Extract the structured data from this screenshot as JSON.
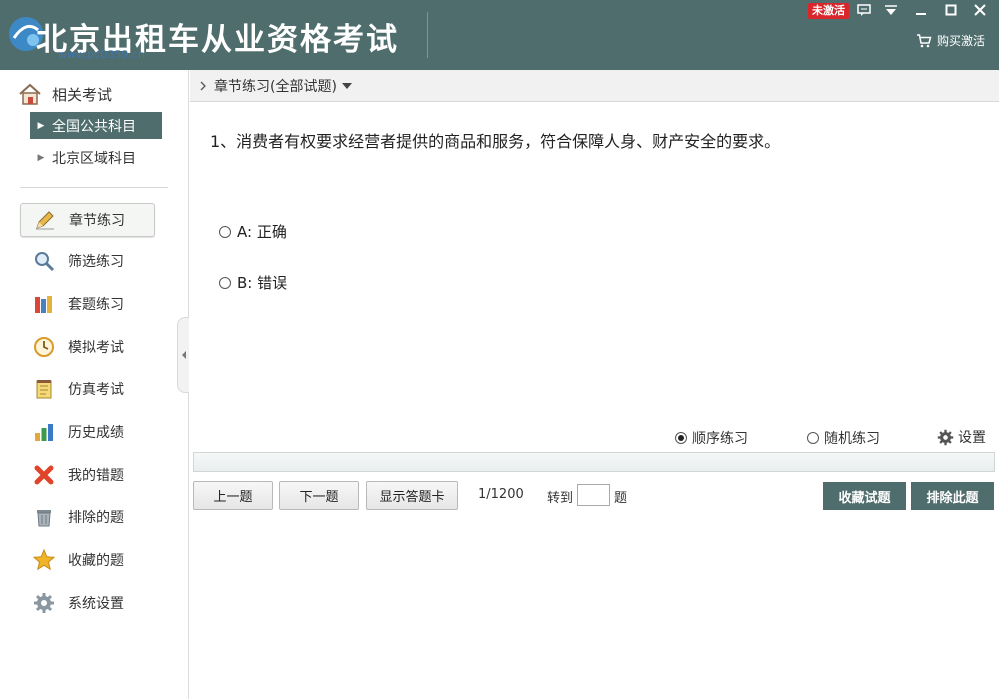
{
  "colors": {
    "accent": "#4f6d6c",
    "badge": "#d9262a"
  },
  "titlebar": {
    "title": "北京出租车从业资格考试",
    "watermark": "www.pc0359.cn",
    "badge": "未激活",
    "buy_label": "购买激活",
    "icons": [
      "chat-icon",
      "dropdown-icon",
      "minimize-icon",
      "maximize-icon",
      "close-icon"
    ]
  },
  "sidebar": {
    "category_label": "相关考试",
    "subjects": [
      {
        "label": "全国公共科目",
        "active": true
      },
      {
        "label": "北京区域科目",
        "active": false
      }
    ],
    "nav": [
      {
        "label": "章节练习",
        "icon": "pencil-icon",
        "active": true
      },
      {
        "label": "筛选练习",
        "icon": "magnifier-icon"
      },
      {
        "label": "套题练习",
        "icon": "books-icon"
      },
      {
        "label": "模拟考试",
        "icon": "clock-icon"
      },
      {
        "label": "仿真考试",
        "icon": "notepad-icon"
      },
      {
        "label": "历史成绩",
        "icon": "bar-chart-icon"
      },
      {
        "label": "我的错题",
        "icon": "red-x-icon"
      },
      {
        "label": "排除的题",
        "icon": "trash-icon"
      },
      {
        "label": "收藏的题",
        "icon": "star-icon"
      },
      {
        "label": "系统设置",
        "icon": "gear-icon"
      }
    ]
  },
  "main": {
    "breadcrumb": "章节练习(全部试题)",
    "question": "1、消费者有权要求经营者提供的商品和服务，符合保障人身、财产安全的要求。",
    "options": [
      {
        "label": "A: 正确"
      },
      {
        "label": "B: 错误"
      }
    ],
    "modes": [
      {
        "label": "顺序练习",
        "checked": true
      },
      {
        "label": "随机练习",
        "checked": false
      }
    ],
    "settings_label": "设置",
    "progress": 0,
    "buttons": {
      "prev": "上一题",
      "next": "下一题",
      "show_card": "显示答题卡",
      "favorite": "收藏试题",
      "exclude": "排除此题"
    },
    "counter": "1/1200",
    "goto_label": "转到",
    "goto_value": "",
    "goto_suffix": "题"
  }
}
